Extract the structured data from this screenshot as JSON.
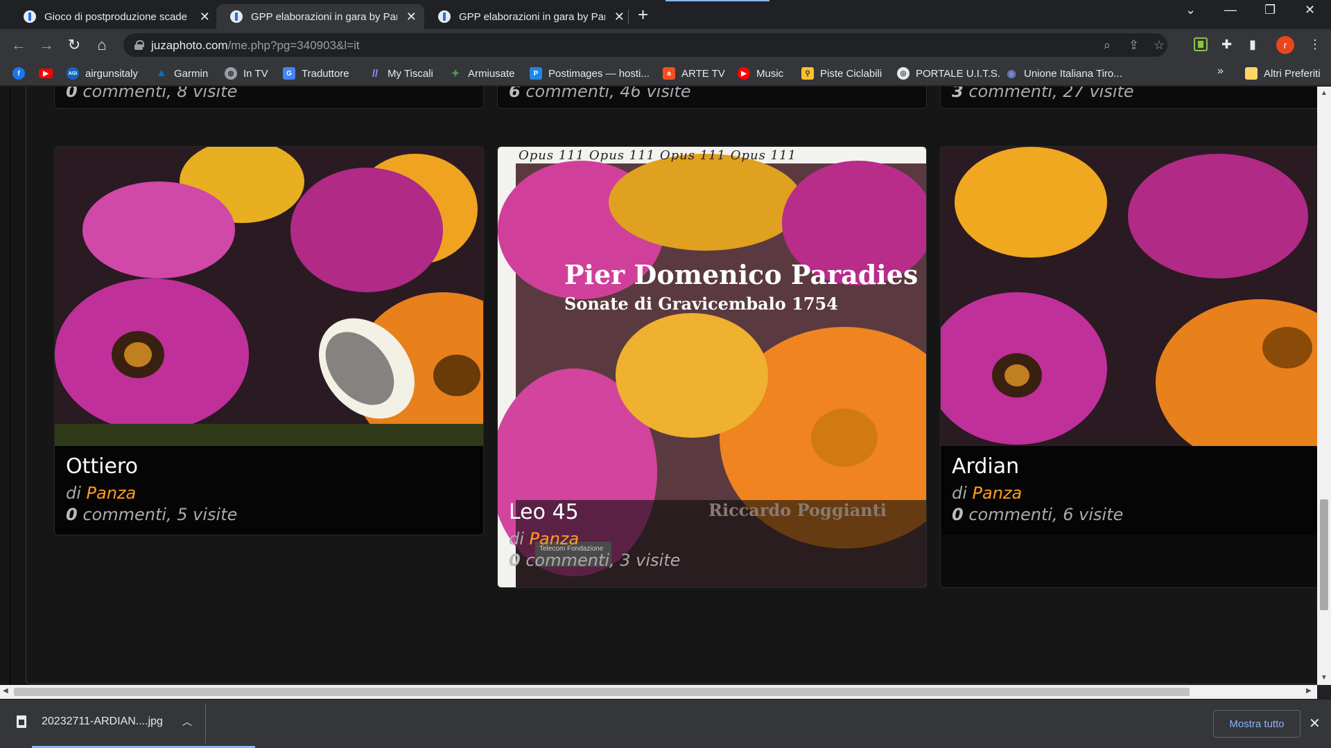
{
  "tabs": [
    {
      "title": "Gioco di postproduzione scade s",
      "active": false
    },
    {
      "title": "GPP elaborazioni in gara by Panz",
      "active": true
    },
    {
      "title": "GPP elaborazioni in gara by Panz",
      "active": false
    }
  ],
  "toolbar": {
    "url_host": "juzaphoto.com",
    "url_path": "/me.php?pg=340903&l=it",
    "profile_initial": "r"
  },
  "bookmarks": [
    {
      "label": "",
      "icon": "facebook-icon",
      "color": "#1877f2"
    },
    {
      "label": "",
      "icon": "youtube-icon",
      "color": "#ff0000"
    },
    {
      "label": "airgunsitaly",
      "icon": "agi-icon",
      "color": "#1565c0"
    },
    {
      "label": "Garmin",
      "icon": "garmin-icon",
      "color": "#0071c5"
    },
    {
      "label": "In TV",
      "icon": "globe-icon",
      "color": "#9aa0a6"
    },
    {
      "label": "Traduttore",
      "icon": "translate-icon",
      "color": "#4285f4"
    },
    {
      "label": "My Tiscali",
      "icon": "tiscali-icon",
      "color": "#6a5acd"
    },
    {
      "label": "Armiusate",
      "icon": "armiusate-icon",
      "color": "#2e7d32"
    },
    {
      "label": "Postimages — hosti...",
      "icon": "postimages-icon",
      "color": "#1e88e5"
    },
    {
      "label": "ARTE TV",
      "icon": "arte-icon",
      "color": "#f4511e"
    },
    {
      "label": "Music",
      "icon": "music-icon",
      "color": "#ff0000"
    },
    {
      "label": "Piste Ciclabili",
      "icon": "bike-icon",
      "color": "#fbc02d"
    },
    {
      "label": "PORTALE U.I.T.S.",
      "icon": "uits-icon",
      "color": "#e8eaed"
    },
    {
      "label": "Unione Italiana Tiro...",
      "icon": "uit-icon",
      "color": "#3949ab"
    }
  ],
  "bookmarks_more": "»",
  "other_bookmarks": "Altri Preferiti",
  "top_row_stats": [
    {
      "comments": "0",
      "rest": " commenti, 8 visite"
    },
    {
      "comments": "6",
      "rest": " commenti, 46 visite"
    },
    {
      "comments": "3",
      "rest": " commenti, 27 visite"
    }
  ],
  "cards": [
    {
      "title": "Ottiero",
      "by_prefix": "di ",
      "author": "Panza",
      "comments": "0",
      "rest": " commenti, 5 visite"
    },
    {
      "title": "Leo 45",
      "by_prefix": "di ",
      "author": "Panza",
      "comments": "0",
      "rest": " commenti, 3 visite"
    },
    {
      "title": "Ardian",
      "by_prefix": "di ",
      "author": "Panza",
      "comments": "0",
      "rest": " commenti, 6 visite"
    }
  ],
  "poster": {
    "border_text": "Opus 111  Opus 111  Opus 111  Opus 111",
    "composer": "Pier Domenico Paradies",
    "work": "Sonate di Gravicembalo 1754",
    "performer": "Riccardo Poggianti",
    "sponsor": "Telecom Fondazione"
  },
  "download": {
    "filename": "20232711-ARDIAN....jpg",
    "show_all": "Mostra tutto"
  },
  "colors": {
    "author": "#ff9e1f",
    "page_bg": "#161616",
    "chrome_bg": "#35363a"
  }
}
